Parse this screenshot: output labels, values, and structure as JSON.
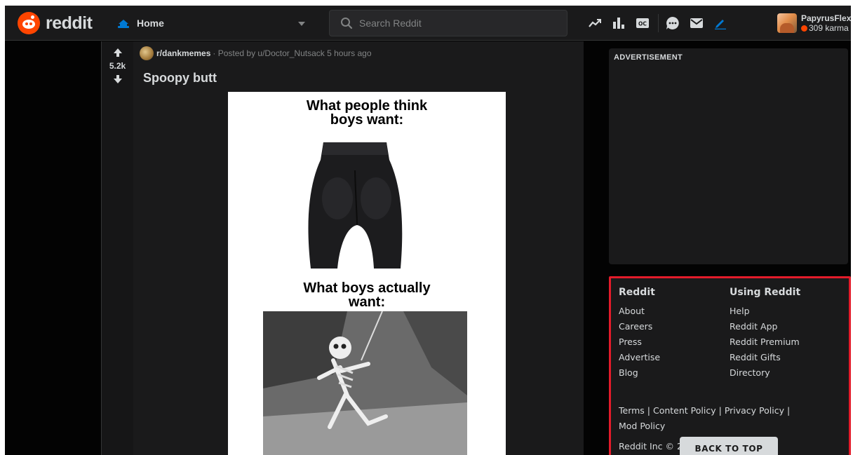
{
  "header": {
    "logo_text": "reddit",
    "home_label": "Home",
    "search_placeholder": "Search Reddit",
    "icons": [
      "trending-icon",
      "leaderboard-icon",
      "closed-caption-icon",
      "chat-icon",
      "mail-icon",
      "create-post-icon"
    ],
    "user": {
      "name": "PapyrusFlex",
      "karma": "309 karma"
    }
  },
  "post": {
    "votes": "5.2k",
    "subreddit": "r/dankmemes",
    "meta": "· Posted by u/Doctor_Nutsack 5 hours ago",
    "title": "Spoopy butt",
    "image": {
      "caption_top_line1": "What people think",
      "caption_top_line2": "boys want:",
      "caption_bottom_line1": "What boys actually",
      "caption_bottom_line2": "want:"
    }
  },
  "sidebar": {
    "ad_label": "ADVERTISEMENT",
    "footer": {
      "col1_title": "Reddit",
      "col1_links": [
        "About",
        "Careers",
        "Press",
        "Advertise",
        "Blog"
      ],
      "col2_title": "Using Reddit",
      "col2_links": [
        "Help",
        "Reddit App",
        "Reddit Premium",
        "Reddit Gifts",
        "Directory"
      ],
      "legal": [
        "Terms",
        "Content Policy",
        "Privacy Policy",
        "Mod Policy"
      ],
      "copyright": "Reddit Inc © 2"
    },
    "back_to_top": "BACK TO TOP"
  },
  "colors": {
    "brand": "#ff4500",
    "background": "#030303",
    "card": "#1a1a1b",
    "text": "#d7dadc",
    "muted": "#818384",
    "highlight_border": "#e31b2a"
  }
}
